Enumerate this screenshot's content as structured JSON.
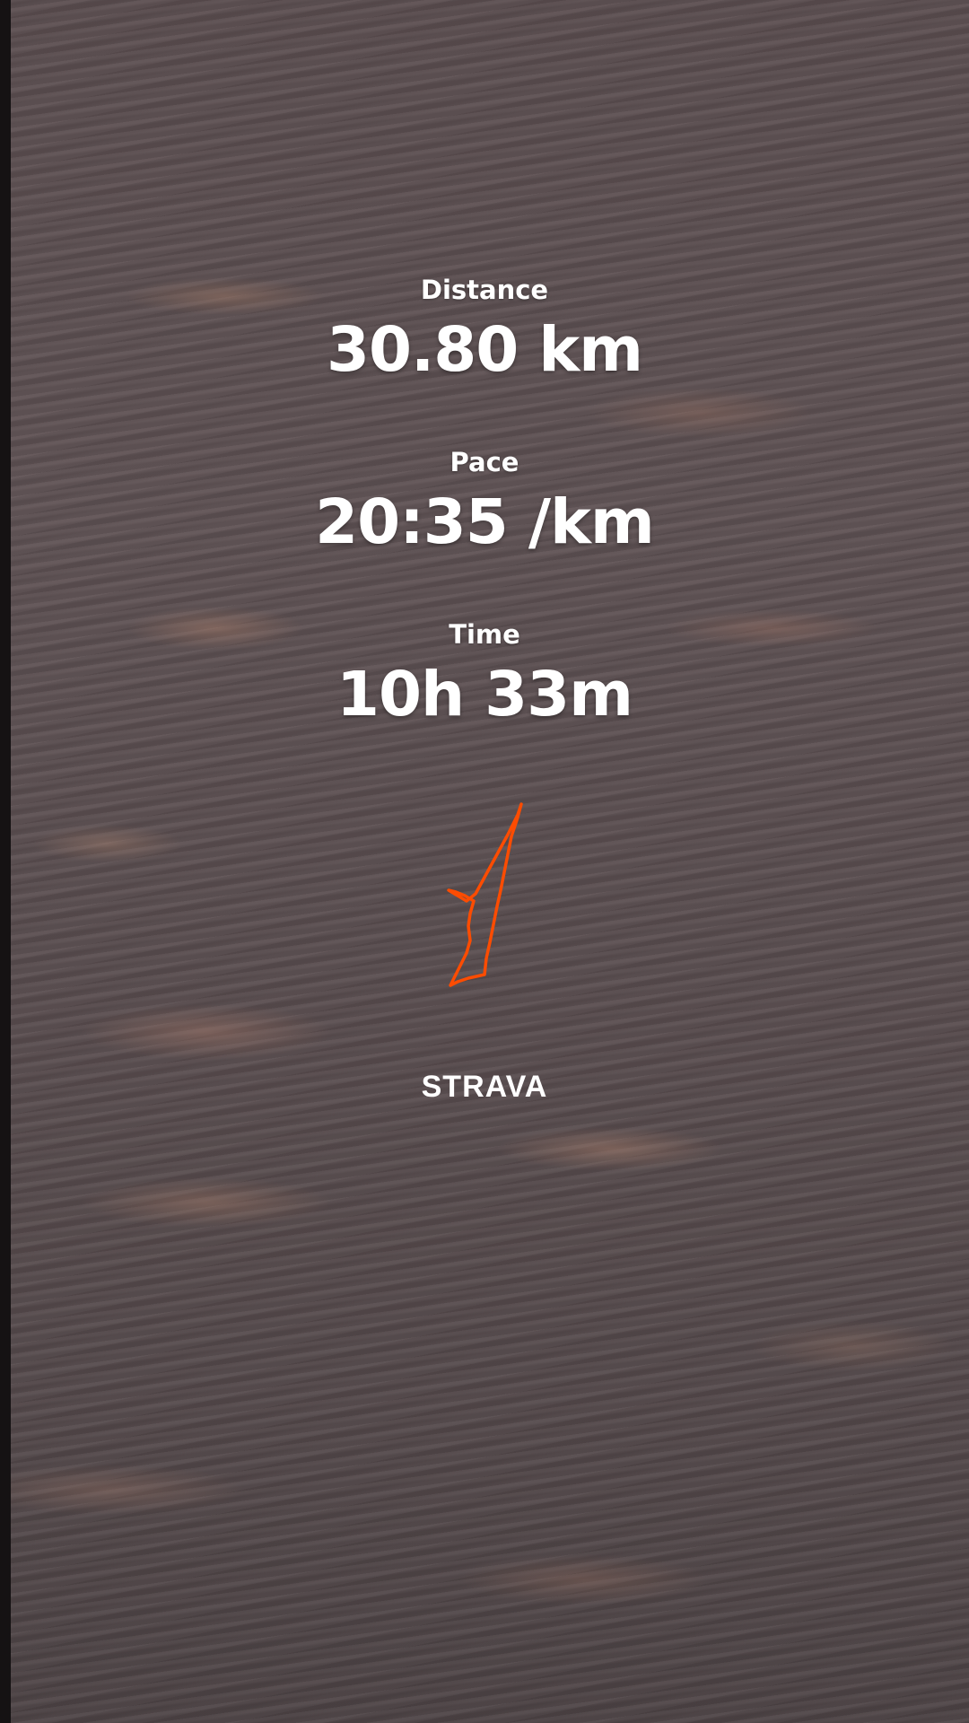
{
  "stats": {
    "distance": {
      "label": "Distance",
      "value": "30.80 km"
    },
    "pace": {
      "label": "Pace",
      "value": "20:35 /km"
    },
    "time": {
      "label": "Time",
      "value": "10h 33m"
    }
  },
  "route": {
    "icon": "route-map-icon",
    "color": "#fc4c02"
  },
  "brand": {
    "logo_text": "STRAVA",
    "color": "#ffffff"
  }
}
